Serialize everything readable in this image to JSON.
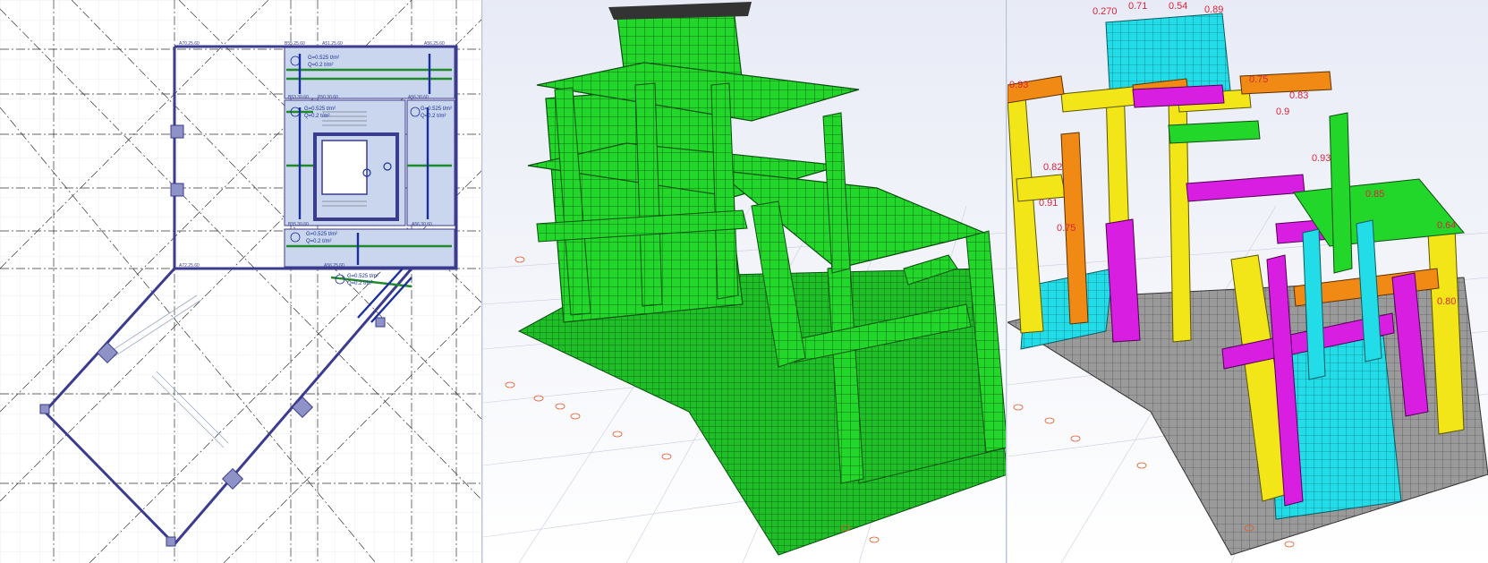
{
  "plan": {
    "beam_labels_top": [
      "A70.25.60",
      "B55.25.60",
      "A51.25.60",
      "A56.25.60"
    ],
    "beam_labels_mid": [
      "B53.30.60",
      "P50.30.60",
      "A56.30.60"
    ],
    "beam_labels_low": [
      "B55.30.60",
      "A56.30.60"
    ],
    "beam_labels_bottom": [
      "A72.25.60",
      "A56.25.60"
    ],
    "load_g": "G=0.525 t/m²",
    "load_q": "Q=0.2 t/m²",
    "colors": {
      "line": "#3b3b8f",
      "slab": "#c9d6ee",
      "grid": "#222222",
      "rebar_green": "#1f8a2a",
      "rebar_blue": "#1a2f9e"
    }
  },
  "model": {
    "colors": {
      "element": "#22d62a",
      "element_dark": "#0f8a18",
      "support": "#e25a2a"
    }
  },
  "results": {
    "ratios": [
      "0.270",
      "0.71",
      "0.54",
      "0.89",
      "0.93",
      "0.75",
      "0.83",
      "0.9",
      "0.82",
      "0.93",
      "0.85",
      "0.64",
      "0.80",
      "0.91",
      "0.75"
    ],
    "colors": {
      "cyan": "#22dce8",
      "yellow": "#f2e618",
      "orange": "#f08a14",
      "magenta": "#d81ee0",
      "green": "#22d62a",
      "grey": "#9a9a9a",
      "ratio_text": "#d8263a"
    }
  }
}
